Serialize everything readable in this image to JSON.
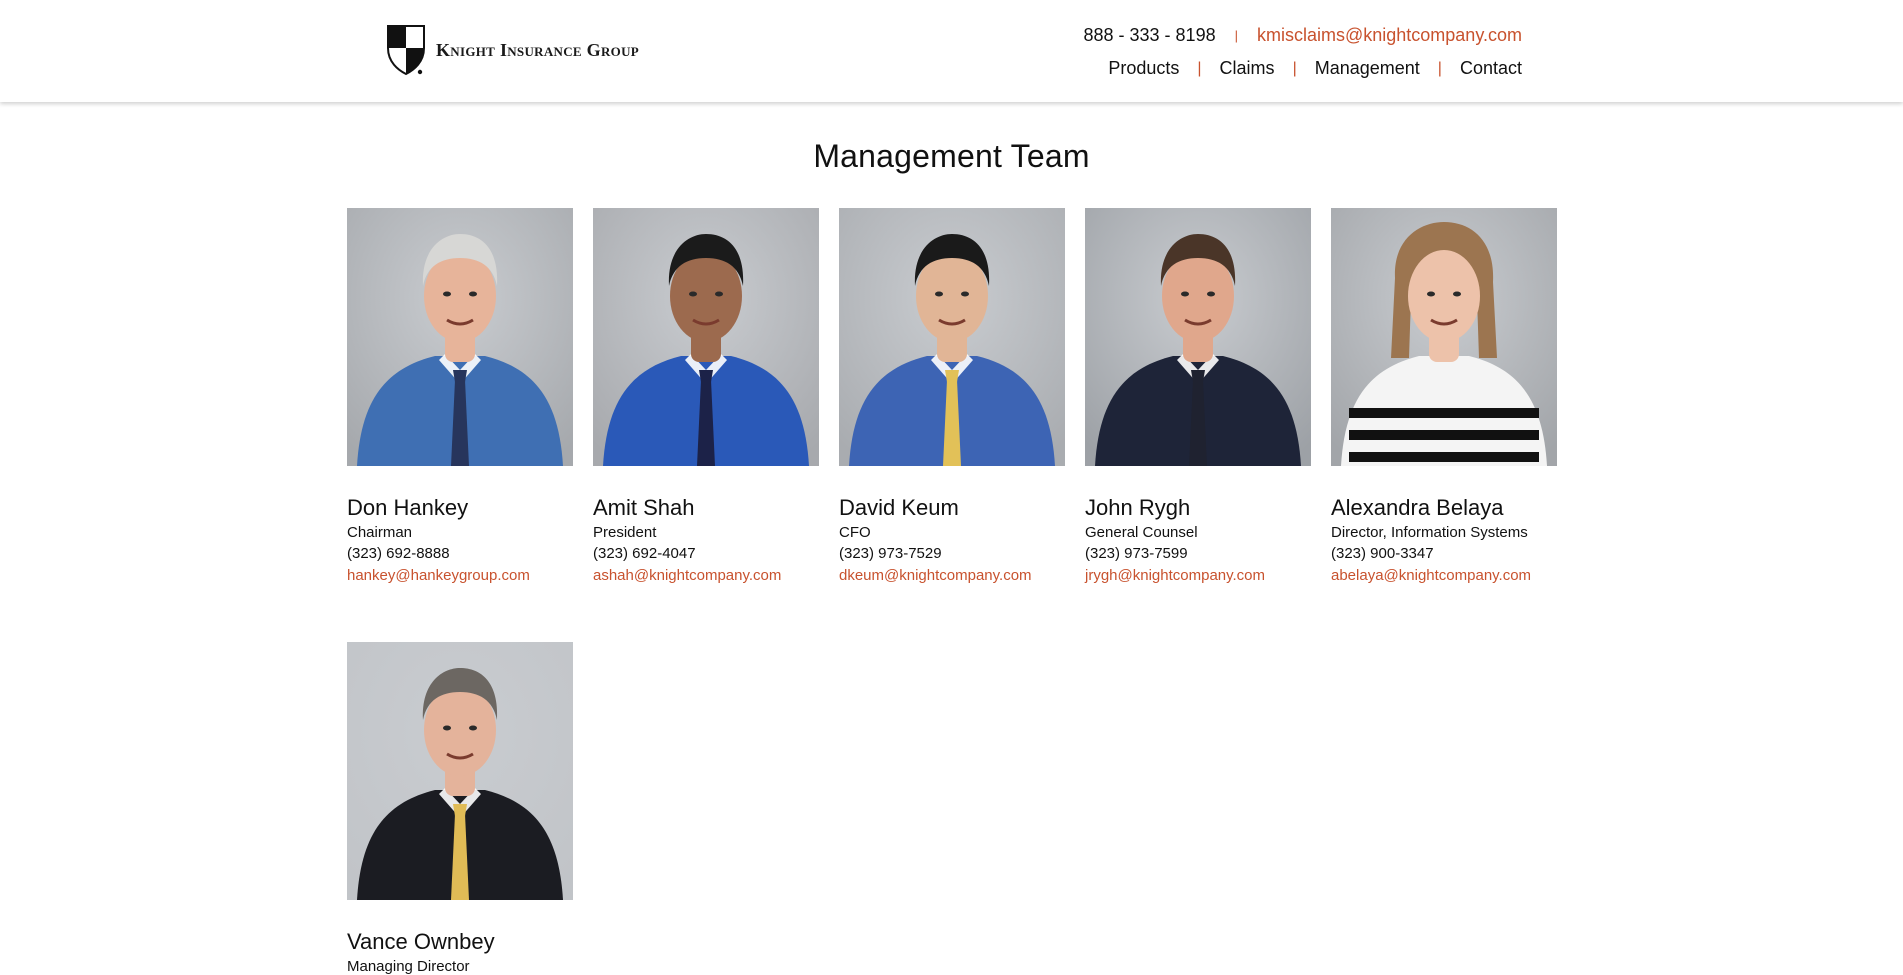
{
  "brand": {
    "name": "Knight Insurance Group",
    "logo_icon": "shield-icon"
  },
  "header": {
    "phone": "888 - 333 - 8198",
    "email": "kmisclaims@knightcompany.com",
    "separator": "|",
    "nav": [
      {
        "label": "Products"
      },
      {
        "label": "Claims"
      },
      {
        "label": "Management"
      },
      {
        "label": "Contact"
      }
    ]
  },
  "page": {
    "title": "Management Team"
  },
  "team": [
    {
      "name": "Don Hankey",
      "role": "Chairman",
      "phone": "(323) 692-8888",
      "email": "hankey@hankeygroup.com",
      "shirt": "#3f6fb3",
      "tie": "#27355c",
      "hair": "#d7d7d5",
      "skin": "#e7b49a",
      "bg": "#a6a9ad"
    },
    {
      "name": "Amit Shah",
      "role": "President",
      "phone": "(323) 692-4047",
      "email": "ashah@knightcompany.com",
      "shirt": "#2a59b8",
      "tie": "#1c2248",
      "hair": "#1b1b1b",
      "skin": "#9c6a4e",
      "bg": "#a7a9ad"
    },
    {
      "name": "David Keum",
      "role": "CFO",
      "phone": "(323) 973-7529",
      "email": "dkeum@knightcompany.com",
      "shirt": "#3d64b4",
      "tie": "#e2c158",
      "hair": "#1a1a1a",
      "skin": "#e1b596",
      "bg": "#a9acb0"
    },
    {
      "name": "John Rygh",
      "role": "General Counsel",
      "phone": "(323) 973-7599",
      "email": "jrygh@knightcompany.com",
      "shirt": "#1e2438",
      "tie": "#1f2230",
      "hair": "#4a3528",
      "skin": "#e0a78c",
      "bg": "#9da1a6"
    },
    {
      "name": "Alexandra Belaya",
      "role": "Director, Information Systems",
      "phone": "(323) 900-3347",
      "email": "abelaya@knightcompany.com",
      "shirt": "#f4f4f4",
      "tie": "",
      "hair": "#9c7550",
      "skin": "#edc2aa",
      "bg": "#a2a5a9"
    },
    {
      "name": "Vance Ownbey",
      "role": "Managing Director",
      "phone": "",
      "email": "",
      "shirt": "#1b1c22",
      "tie": "#e0bb56",
      "hair": "#6c6762",
      "skin": "#e4b39b",
      "bg": "#c1c4c8"
    }
  ]
}
